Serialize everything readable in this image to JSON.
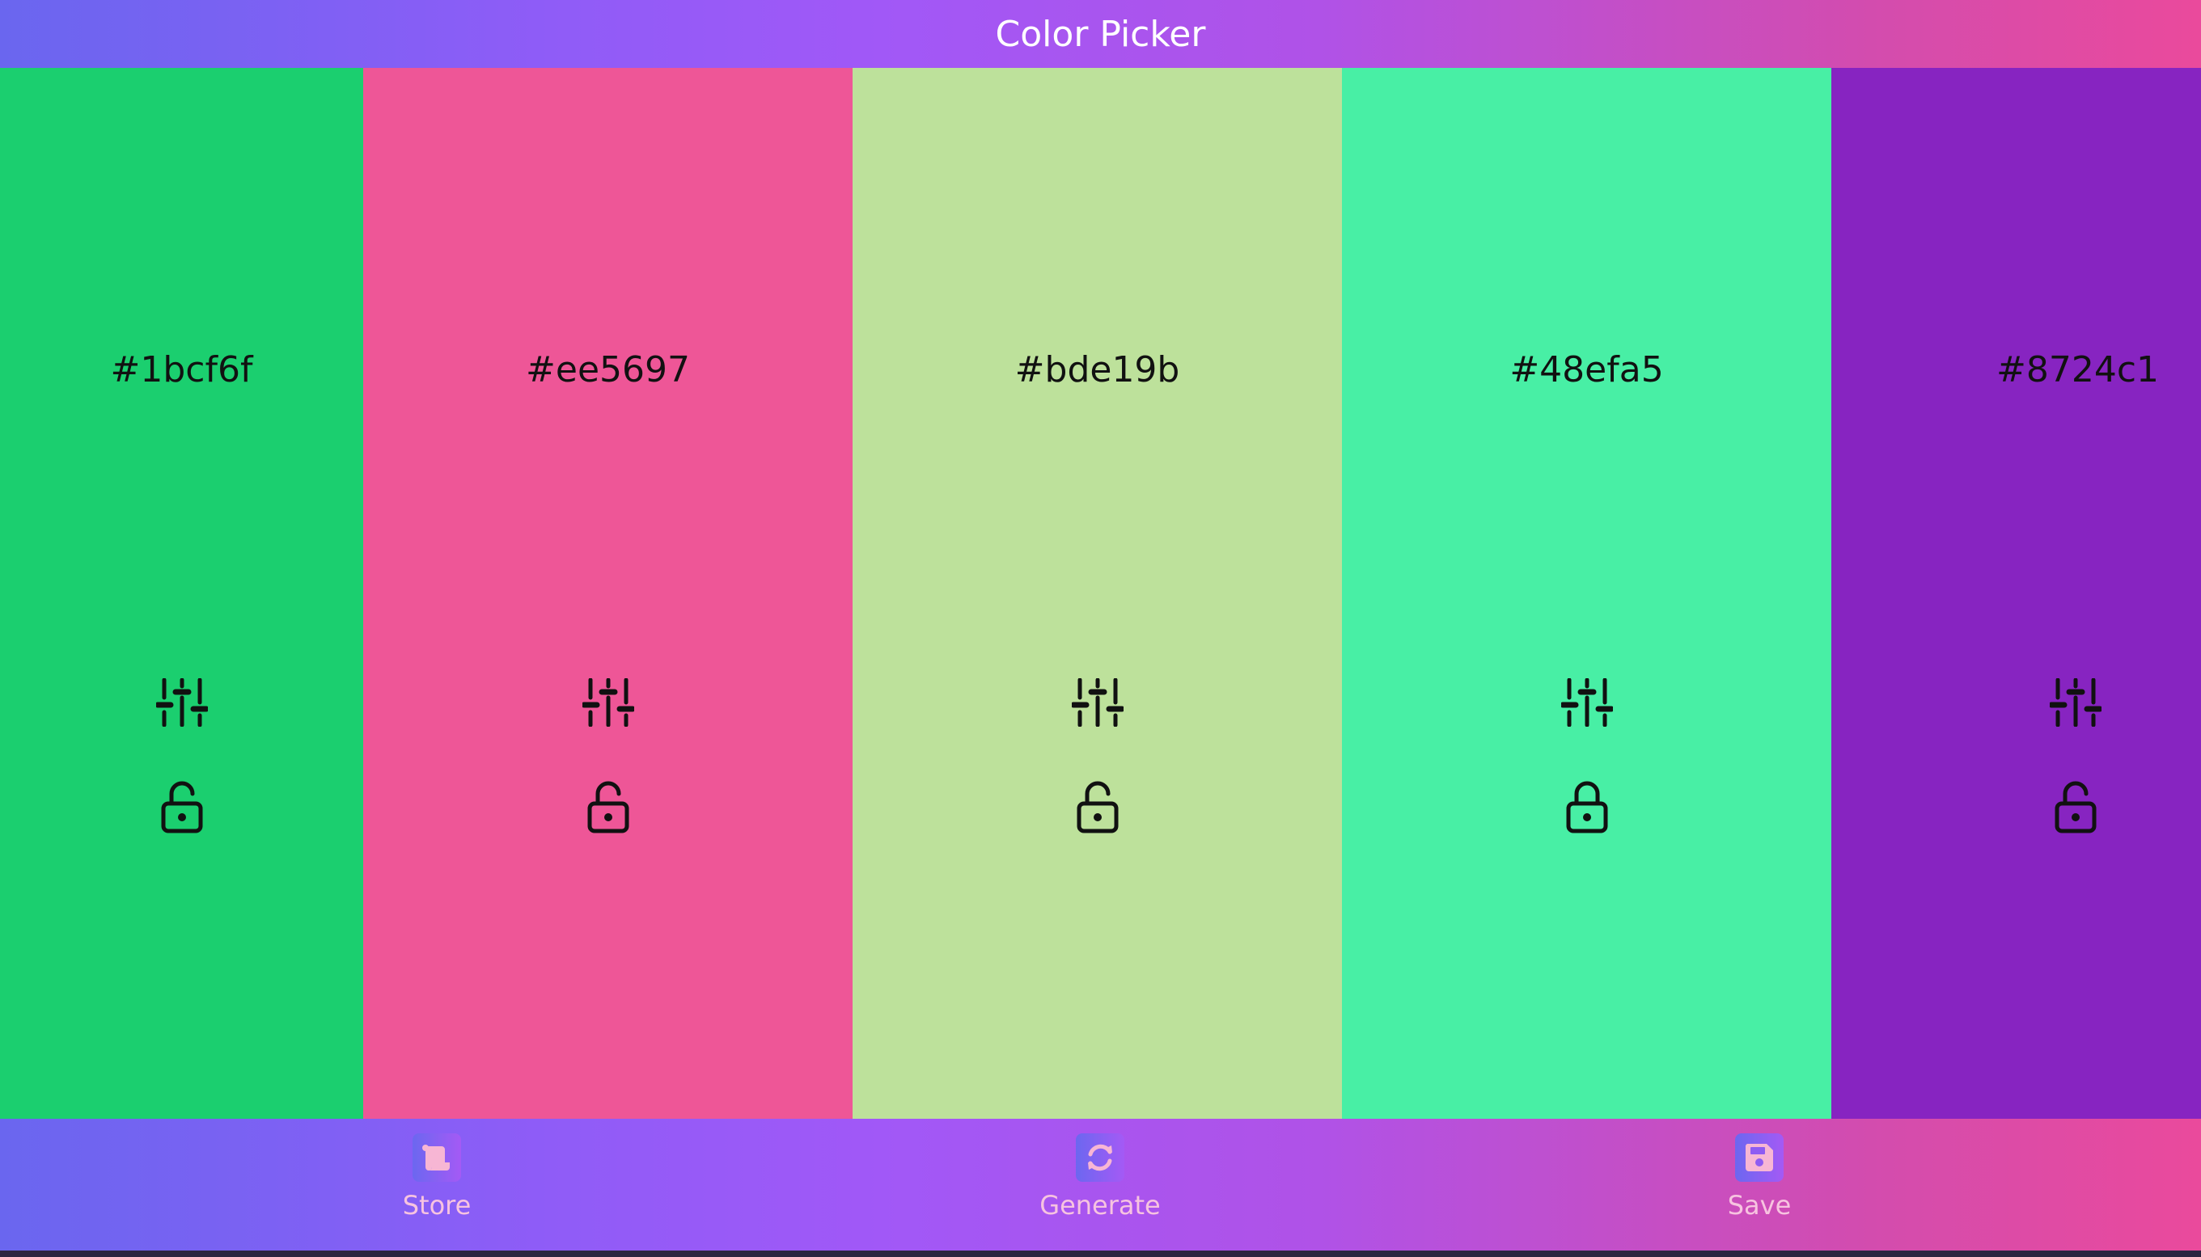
{
  "header": {
    "title": "Color Picker"
  },
  "palette": [
    {
      "hex": "#1bcf6f",
      "color": "#1bcf6f",
      "lock_state": "unlocked"
    },
    {
      "hex": "#ee5697",
      "color": "#ee5697",
      "lock_state": "unlocked"
    },
    {
      "hex": "#bde19b",
      "color": "#bde19b",
      "lock_state": "unlocked"
    },
    {
      "hex": "#48efa5",
      "color": "#48efa5",
      "lock_state": "locked"
    },
    {
      "hex": "#8724c1",
      "color": "#8724c1",
      "lock_state": "unlocked"
    }
  ],
  "icons": {
    "adjust": "sliders-icon",
    "lock_open": "lock-open-icon",
    "lock_closed": "lock-closed-icon",
    "store": "scroll-icon",
    "generate": "refresh-icon",
    "save": "floppy-disk-icon"
  },
  "footer": {
    "store_label": "Store",
    "generate_label": "Generate",
    "save_label": "Save"
  },
  "colors": {
    "header_gradient_start": "#6a66ef",
    "header_gradient_mid": "#a158f7",
    "header_gradient_end": "#ea4a9c",
    "footer_label": "#f7c3e0"
  }
}
